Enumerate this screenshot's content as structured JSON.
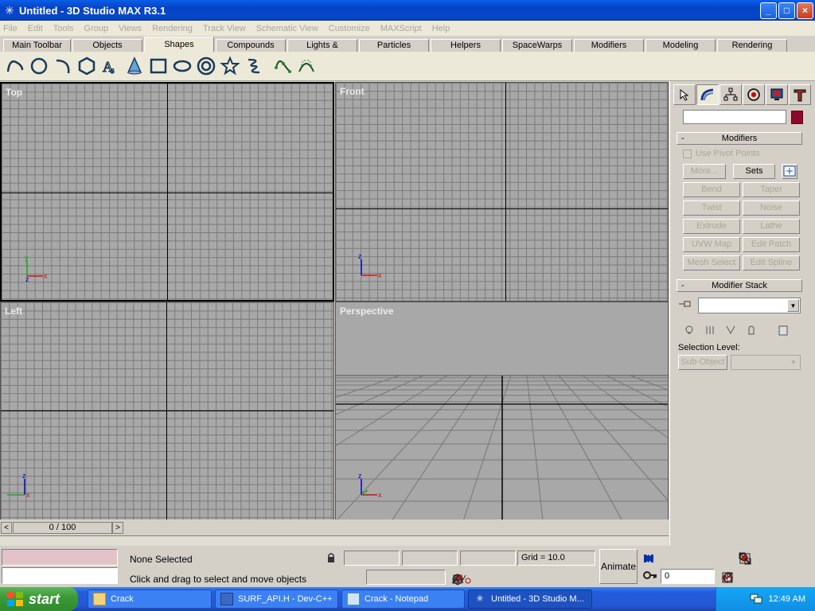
{
  "window": {
    "title": "Untitled - 3D Studio MAX R3.1",
    "min": "_",
    "max": "□",
    "close": "×"
  },
  "menu": [
    "File",
    "Edit",
    "Tools",
    "Group",
    "Views",
    "Rendering",
    "Track View",
    "Schematic View",
    "Customize",
    "MAXScript",
    "Help"
  ],
  "tabs": [
    "Main Toolbar",
    "Objects",
    "Shapes",
    "Compounds",
    "Lights & Cameras",
    "Particles",
    "Helpers",
    "SpaceWarps",
    "Modifiers",
    "Modeling",
    "Rendering"
  ],
  "active_tab": "Shapes",
  "shape_tools": [
    "line-icon",
    "circle-icon",
    "arc-icon",
    "ngon-icon",
    "text-icon",
    "cone-shape-icon",
    "rectangle-icon",
    "ellipse-icon",
    "donut-icon",
    "star-icon",
    "helix-icon",
    "nurbs-point-curve-icon",
    "nurbs-cv-curve-icon"
  ],
  "viewports": {
    "top": "Top",
    "front": "Front",
    "left": "Left",
    "perspective": "Perspective"
  },
  "command_panel": {
    "modifiers_title": "Modifiers",
    "use_pivot": "Use Pivot Points",
    "more": "More...",
    "sets": "Sets",
    "buttons": [
      [
        "Bend",
        "Taper"
      ],
      [
        "Twist",
        "Noise"
      ],
      [
        "Extrude",
        "Lathe"
      ],
      [
        "UVW Map",
        "Edit Patch"
      ],
      [
        "Mesh Select",
        "Edit Spline"
      ]
    ],
    "stack_title": "Modifier Stack",
    "selection_level": "Selection Level:",
    "sub_object": "Sub-Object",
    "name_value": "",
    "color": "#8b0a2c"
  },
  "timeline": {
    "frame": "0 / 100",
    "prev": "<",
    "next": ">"
  },
  "status": {
    "selected": "None Selected",
    "prompt": "Click and drag to select and move objects",
    "grid": "Grid = 10.0",
    "animate": "Animate",
    "frame_value": "0"
  },
  "taskbar": {
    "start": "start",
    "items": [
      "Crack",
      "SURF_API.H - Dev-C++",
      "Crack - Notepad",
      "Untitled - 3D Studio M..."
    ],
    "clock": "12:49 AM"
  }
}
